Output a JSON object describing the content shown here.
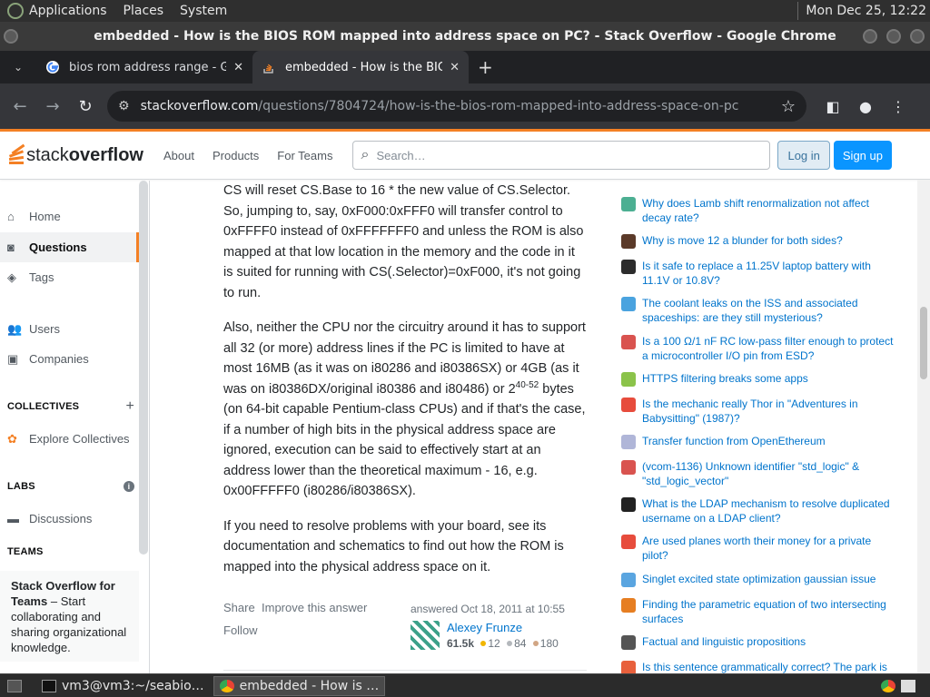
{
  "desktop": {
    "menus": [
      "Applications",
      "Places",
      "System"
    ],
    "clock": "Mon Dec 25, 12:22"
  },
  "window": {
    "title": "embedded - How is the BIOS ROM mapped into address space on PC? - Stack Overflow - Google Chrome"
  },
  "tabs": [
    {
      "title": "bios rom address range - Goo",
      "close": "✕"
    },
    {
      "title": "embedded - How is the BIOS",
      "close": "✕"
    }
  ],
  "newtab": "+",
  "toolbar": {
    "url_domain": "stackoverflow.com",
    "url_path": "/questions/7804724/how-is-the-bios-rom-mapped-into-address-space-on-pc"
  },
  "so": {
    "logo_light": "stack",
    "logo_bold": "overflow",
    "nav": [
      "About",
      "Products",
      "For Teams"
    ],
    "search_placeholder": "Search…",
    "login": "Log in",
    "signup": "Sign up",
    "brand_color": "#f48024"
  },
  "sidebar": {
    "home": "Home",
    "questions": "Questions",
    "tags": "Tags",
    "users": "Users",
    "companies": "Companies",
    "collectives_header": "COLLECTIVES",
    "explore_collectives": "Explore Collectives",
    "labs_header": "LABS",
    "discussions": "Discussions",
    "teams_header": "TEAMS",
    "teams_title": "Stack Overflow for Teams",
    "teams_text": " – Start collaborating and sharing organizational knowledge."
  },
  "answer": {
    "p1": "CS will reset CS.Base to 16 * the new value of CS.Selector. So, jumping to, say, 0xF000:0xFFF0 will transfer control to 0xFFFF0 instead of 0xFFFFFFF0 and unless the ROM is also mapped at that low location in the memory and the code in it is suited for running with CS(.Selector)=0xF000, it's not going to run.",
    "p2_a": "Also, neither the CPU nor the circuitry around it has to support all 32 (or more) address lines if the PC is limited to have at most 16MB (as it was on i80286 and i80386SX) or 4GB (as it was on i80386DX/original i80386 and i80486) or 2",
    "p2_sup": "40-52",
    "p2_b": " bytes (on 64-bit capable Pentium-class CPUs) and if that's the case, if a number of high bits in the physical address space are ignored, execution can be said to effectively start at an address lower than the theoretical maximum - 16, e.g. 0x00FFFFF0 (i80286/i80386SX).",
    "p3": "If you need to resolve problems with your board, see its documentation and schematics to find out how the ROM is mapped into the physical address space on it.",
    "share": "Share",
    "improve": "Improve this answer",
    "follow": "Follow",
    "answered": "answered Oct 18, 2011 at 10:55",
    "user": "Alexey Frunze",
    "rep": "61.5k",
    "gold": "12",
    "silver": "84",
    "bronze": "180"
  },
  "hnq": [
    {
      "title": "Why does Lamb shift renormalization not affect decay rate?",
      "icon_color": "#4caf92"
    },
    {
      "title": "Why is move 12 a blunder for both sides?",
      "icon_color": "#5b3a29"
    },
    {
      "title": "Is it safe to replace a 11.25V laptop battery with 11.1V or 10.8V?",
      "icon_color": "#2c2c2c"
    },
    {
      "title": "The coolant leaks on the ISS and associated spaceships: are they still mysterious?",
      "icon_color": "#4aa3df"
    },
    {
      "title": "Is a 100 Ω/1 nF RC low-pass filter enough to protect a microcontroller I/O pin from ESD?",
      "icon_color": "#d9534f"
    },
    {
      "title": "HTTPS filtering breaks some apps",
      "icon_color": "#8bc34a"
    },
    {
      "title": "Is the mechanic really Thor in \"Adventures in Babysitting\" (1987)?",
      "icon_color": "#e74c3c"
    },
    {
      "title": "Transfer function from OpenEthereum",
      "icon_color": "#b0b6d8"
    },
    {
      "title": "(vcom-1136) Unknown identifier \"std_logic\" & \"std_logic_vector\"",
      "icon_color": "#d9534f"
    },
    {
      "title": "What is the LDAP mechanism to resolve duplicated username on a LDAP client?",
      "icon_color": "#222222"
    },
    {
      "title": "Are used planes worth their money for a private pilot?",
      "icon_color": "#e74c3c"
    },
    {
      "title": "Singlet excited state optimization gaussian issue",
      "icon_color": "#5aa5e0"
    },
    {
      "title": "Finding the parametric equation of two intersecting surfaces",
      "icon_color": "#e67e22"
    },
    {
      "title": "Factual and linguistic propositions",
      "icon_color": "#555555"
    },
    {
      "title": "Is this sentence grammatically correct? The park is",
      "icon_color": "#e8603c"
    }
  ],
  "taskbar": {
    "terminal": "vm3@vm3:~/seabio…",
    "chrome": "embedded - How is …"
  }
}
